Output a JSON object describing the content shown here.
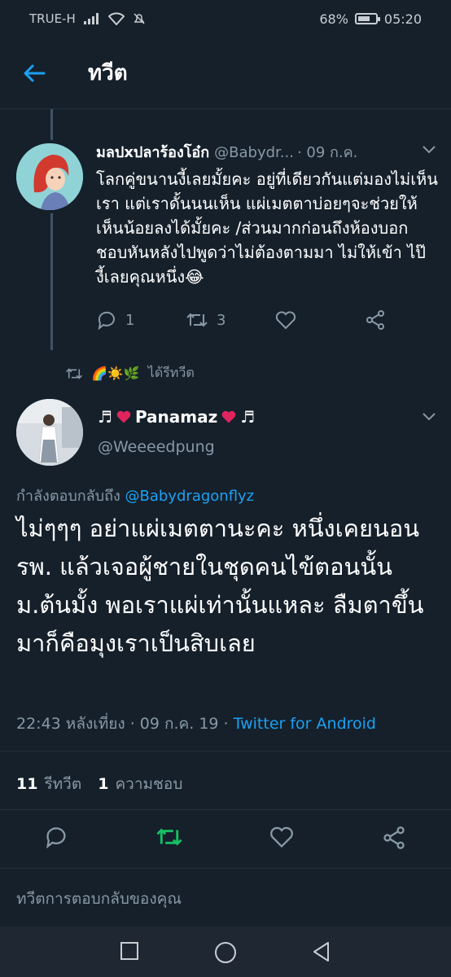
{
  "status": {
    "carrier": "TRUE-H",
    "battery": "68%",
    "time": "05:20"
  },
  "header": {
    "title": "ทวีต"
  },
  "reply": {
    "name": "มลปxปลาร้องโอ๋ก",
    "handle": "@Babydr...",
    "date": "· 09 ก.ค.",
    "text": "โลกคู่ขนานงี้เลยมั้ยคะ อยู่ที่เดียวกันแต่มองไม่เห็นเรา แต่เราดั้นนนเห็น แผ่เมตตาบ่อยๆจะช่วยให้เห็นน้อยลงได้มั้ยคะ /ส่วนมากก่อนถึงห้องบอกชอบหันหลังไปพูดว่าไม่ต้องตามมา ไม่ให้เข้า  ไป๊ งี้เลยคุณหนึ่ง😂",
    "reply_count": "1",
    "retweet_count": "3"
  },
  "retweeted_by": {
    "emoji": "🌈☀️🌿",
    "label": "ได้รีทวีต"
  },
  "tweet": {
    "name": "Panamaz",
    "name_prefix": "♬",
    "name_suffix": "♬",
    "handle": "@Weeeedpung",
    "replying_label": "กำลังตอบกลับถึง",
    "replying_to": "@Babydragonflyz",
    "text": "ไม่ๆๆๆ อย่าแผ่เมตตานะคะ หนึ่งเคยนอนรพ. แล้วเจอผู้ชายในชุดคนไข้ตอนนั้นม.ต้นมั้ง พอเราแผ่เท่านั้นแหละ ลืมตาขึ้นมาก็คือมุงเราเป็นสิบเลย",
    "time": "22:43 หลังเที่ยง · 09 ก.ค. 19 ·",
    "source": "Twitter for Android",
    "retweets": "11",
    "retweets_label": "รีทวีต",
    "likes": "1",
    "likes_label": "ความชอบ"
  },
  "compose": {
    "placeholder": "ทวีตการตอบกลับของคุณ"
  },
  "colors": {
    "background": "#15202b",
    "accent": "#1da1f2",
    "retweet_green": "#17bf63",
    "muted": "#8899a6",
    "heart": "#e0245e"
  }
}
